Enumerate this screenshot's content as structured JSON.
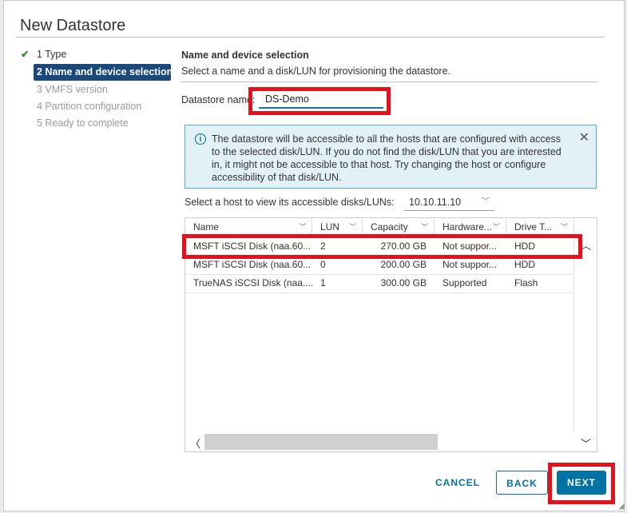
{
  "dialog": {
    "title": "New Datastore"
  },
  "steps": [
    {
      "label": "1 Type",
      "state": "done"
    },
    {
      "label": "2 Name and device selection",
      "state": "active"
    },
    {
      "label": "3 VMFS version",
      "state": "pending"
    },
    {
      "label": "4 Partition configuration",
      "state": "pending"
    },
    {
      "label": "5 Ready to complete",
      "state": "pending"
    }
  ],
  "section": {
    "title": "Name and device selection",
    "description": "Select a name and a disk/LUN for provisioning the datastore."
  },
  "datastore": {
    "label": "Datastore name:",
    "value": "DS-Demo"
  },
  "alert": {
    "icon": "info-icon",
    "text": "The datastore will be accessible to all the hosts that are configured with access to the selected disk/LUN. If you do not find the disk/LUN that you are interested in, it might not be accessible to that host. Try changing the host or configure accessibility of that disk/LUN."
  },
  "host": {
    "label": "Select a host to view its accessible disks/LUNs:",
    "value": "10.10.11.10"
  },
  "table": {
    "columns": [
      "Name",
      "LUN",
      "Capacity",
      "Hardware...",
      "Drive T..."
    ],
    "rows": [
      [
        "MSFT iSCSI Disk (naa.60...",
        "2",
        "270.00 GB",
        "Not suppor...",
        "HDD"
      ],
      [
        "MSFT iSCSI Disk (naa.60...",
        "0",
        "200.00 GB",
        "Not suppor...",
        "HDD"
      ],
      [
        "TrueNAS iSCSI Disk (naa....",
        "1",
        "300.00 GB",
        "Supported",
        "Flash"
      ]
    ]
  },
  "buttons": {
    "cancel": "CANCEL",
    "back": "BACK",
    "next": "NEXT"
  },
  "colors": {
    "accent": "#0072a3",
    "highlight": "#e3111b",
    "active_step": "#1b4a7a"
  }
}
